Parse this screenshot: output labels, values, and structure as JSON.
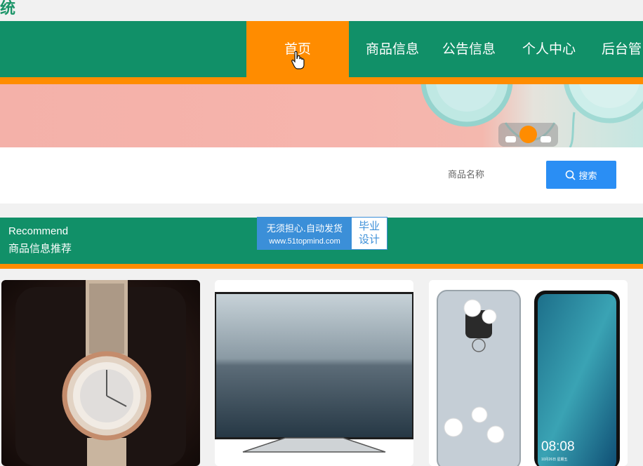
{
  "site": {
    "title_fragment": "统"
  },
  "nav": {
    "items": [
      {
        "label": "首页",
        "active": true
      },
      {
        "label": "商品信息",
        "active": false
      },
      {
        "label": "公告信息",
        "active": false
      },
      {
        "label": "个人中心",
        "active": false
      },
      {
        "label": "后台管",
        "active": false
      }
    ]
  },
  "search": {
    "label": "商品名称",
    "button_label": "搜索"
  },
  "recommend": {
    "title_en": "Recommend",
    "title_cn": "商品信息推荐"
  },
  "watermark": {
    "line1": "无须担心.自动发货",
    "line2": "www.51topmind.com",
    "badge_line1": "毕业",
    "badge_line2": "设计"
  },
  "products": [
    {
      "image": "watch"
    },
    {
      "image": "television"
    },
    {
      "image": "phone"
    }
  ],
  "phone_screen": {
    "time": "08:08",
    "date": "10月26日 星期五"
  },
  "colors": {
    "primary": "#119068",
    "accent": "#ff8c00",
    "button": "#2a8ef4"
  }
}
